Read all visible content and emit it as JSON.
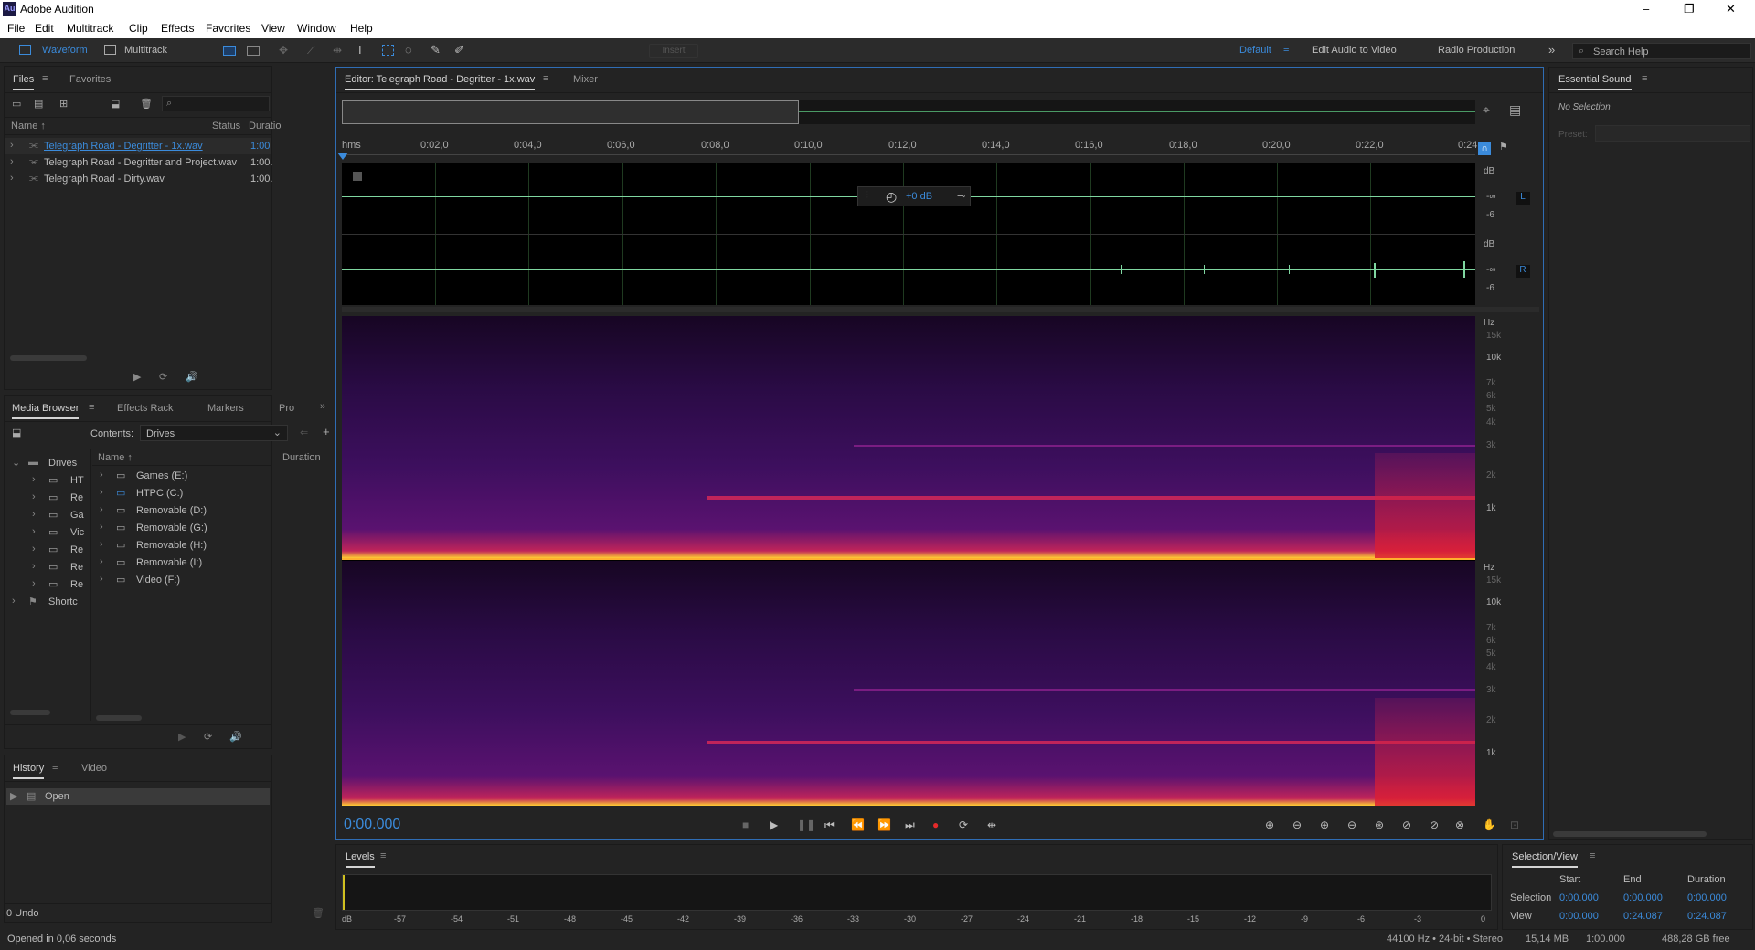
{
  "titlebar": {
    "app_icon": "Au",
    "title": "Adobe Audition",
    "minimize": "–",
    "restore": "❐",
    "close": "✕"
  },
  "menu": [
    "File",
    "Edit",
    "Multitrack",
    "Clip",
    "Effects",
    "Favorites",
    "View",
    "Window",
    "Help"
  ],
  "toolbar": {
    "waveform": "Waveform",
    "multitrack": "Multitrack",
    "insert": "Insert",
    "workspaces": [
      "Default",
      "Edit Audio to Video",
      "Radio Production"
    ],
    "overflow": "»",
    "search_placeholder": "Search Help"
  },
  "files_panel": {
    "tabs": [
      "Files",
      "Favorites"
    ],
    "columns": {
      "name": "Name ↑",
      "status": "Status",
      "duration": "Duratio"
    },
    "files": [
      {
        "name": "Telegraph Road - Degritter - 1x.wav",
        "duration": "1:00",
        "selected": true
      },
      {
        "name": "Telegraph Road - Degritter and Project.wav",
        "duration": "1:00."
      },
      {
        "name": "Telegraph Road - Dirty.wav",
        "duration": "1:00."
      }
    ]
  },
  "media_browser": {
    "tabs": [
      "Media Browser",
      "Effects Rack",
      "Markers",
      "Pro"
    ],
    "contents_label": "Contents:",
    "contents_value": "Drives",
    "tree": [
      "Drives",
      "HT",
      "Re",
      "Ga",
      "Vic",
      "Re",
      "Re",
      "Re",
      "Shortc"
    ],
    "columns": {
      "name": "Name ↑",
      "duration": "Duration"
    },
    "drives": [
      "Games (E:)",
      "HTPC (C:)",
      "Removable (D:)",
      "Removable (G:)",
      "Removable (H:)",
      "Removable (I:)",
      "Video (F:)"
    ]
  },
  "history_panel": {
    "tabs": [
      "History",
      "Video"
    ],
    "items": [
      "Open"
    ],
    "undo": "0 Undo"
  },
  "status_left": "Opened in 0,06 seconds",
  "editor": {
    "tabs": [
      "Editor: Telegraph Road - Degritter - 1x.wav",
      "Mixer"
    ],
    "ruler": [
      "hms",
      "0:02,0",
      "0:04,0",
      "0:06,0",
      "0:08,0",
      "0:10,0",
      "0:12,0",
      "0:14,0",
      "0:16,0",
      "0:18,0",
      "0:20,0",
      "0:22,0",
      "0:24"
    ],
    "hud_gain": "+0 dB",
    "channel_labels": [
      "L",
      "R"
    ],
    "db_scale_top": [
      "dB",
      "-∞",
      "-6"
    ],
    "db_scale_bottom": [
      "dB",
      "-∞",
      "-6"
    ],
    "hz_scale": [
      "Hz",
      "15k",
      "10k",
      "7k",
      "6k",
      "5k",
      "4k",
      "3k",
      "2k",
      "1k"
    ],
    "time": "0:00.000"
  },
  "essential_sound": {
    "title": "Essential Sound",
    "no_selection": "No Selection",
    "preset": "Preset:"
  },
  "levels": {
    "title": "Levels",
    "scale": [
      "dB",
      "-57",
      "-54",
      "-51",
      "-48",
      "-45",
      "-42",
      "-39",
      "-36",
      "-33",
      "-30",
      "-27",
      "-24",
      "-21",
      "-18",
      "-15",
      "-12",
      "-9",
      "-6",
      "-3",
      "0"
    ]
  },
  "selection_view": {
    "title": "Selection/View",
    "headers": [
      "Start",
      "End",
      "Duration"
    ],
    "rows": [
      {
        "label": "Selection",
        "start": "0:00.000",
        "end": "0:00.000",
        "duration": "0:00.000"
      },
      {
        "label": "View",
        "start": "0:00.000",
        "end": "0:24.087",
        "duration": "0:24.087"
      }
    ]
  },
  "statusbar": {
    "format": "44100 Hz • 24-bit • Stereo",
    "size": "15,14 MB",
    "duration": "1:00.000",
    "free": "488,28 GB free"
  },
  "colors": {
    "accent": "#3b8bdb",
    "waveform": "#7fd6a0",
    "record": "#e52a2a"
  }
}
